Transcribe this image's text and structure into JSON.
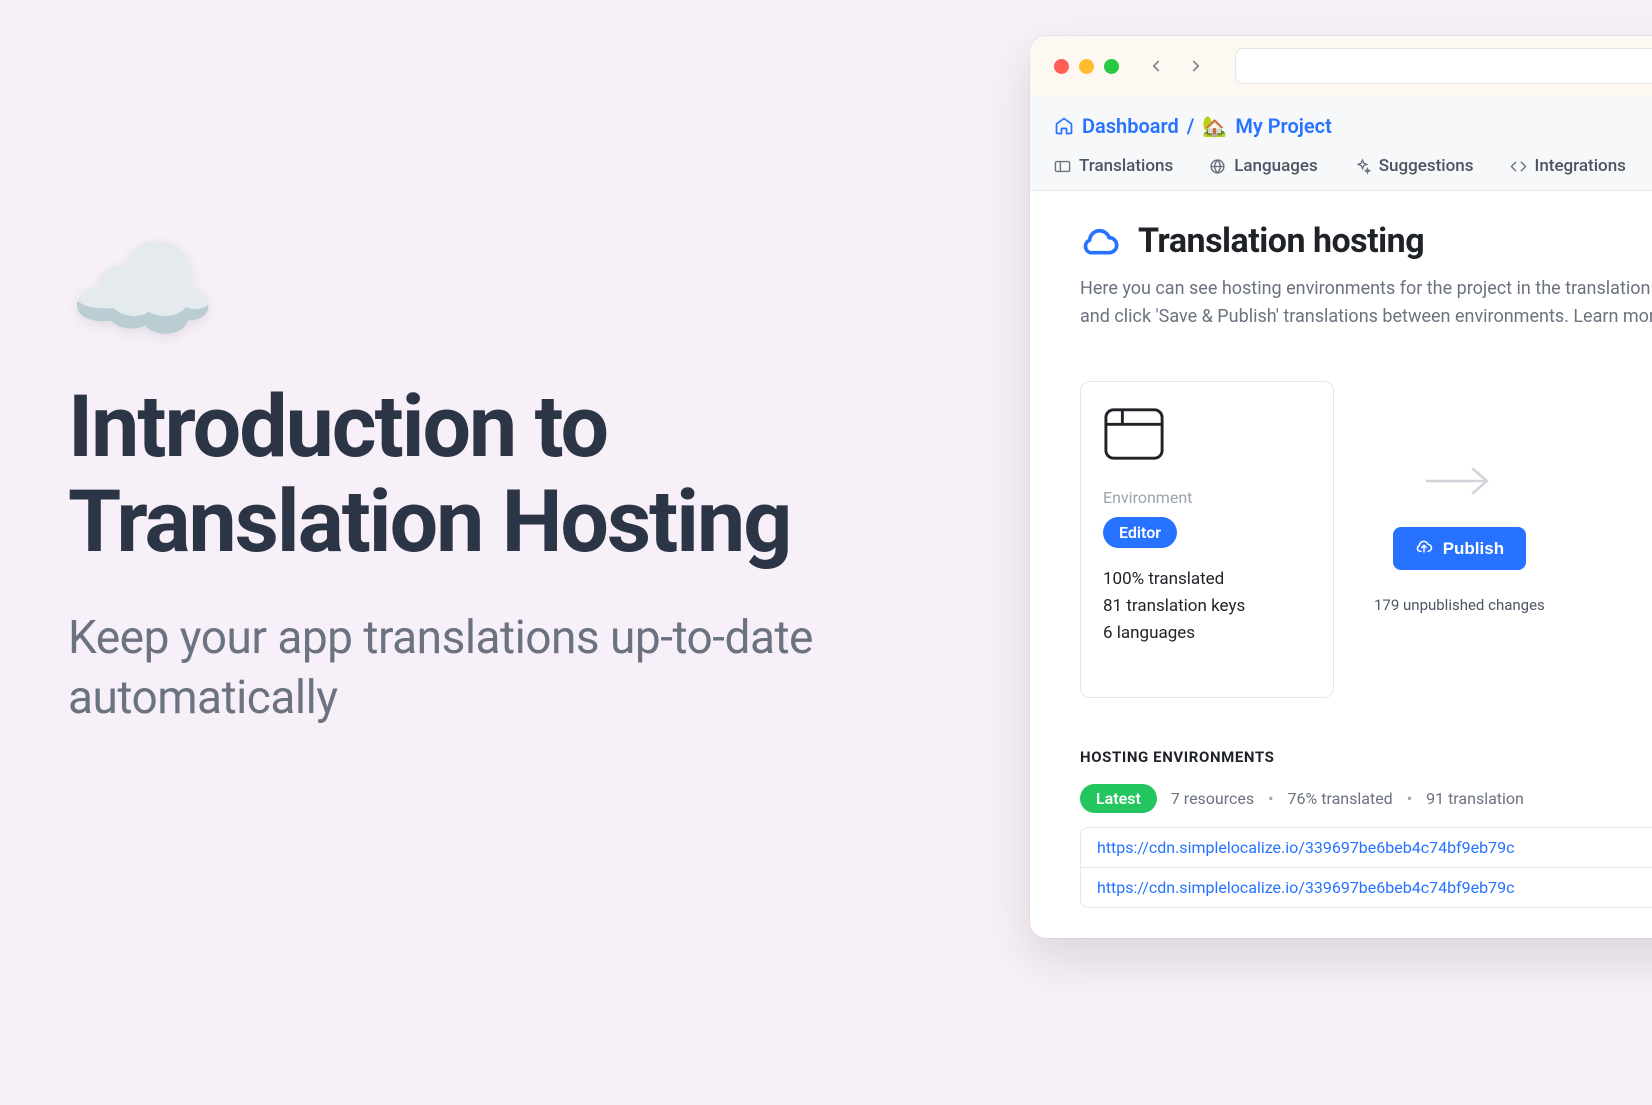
{
  "left": {
    "emoji": "☁️",
    "headline": "Introduction to Translation Hosting",
    "subhead": "Keep your app translations up-to-date automatically"
  },
  "breadcrumb": {
    "dashboard": "Dashboard",
    "project_emoji": "🏡",
    "project_name": "My Project"
  },
  "tabs": {
    "translations": "Translations",
    "languages": "Languages",
    "suggestions": "Suggestions",
    "integrations": "Integrations"
  },
  "page": {
    "title": "Translation hosting",
    "desc": "Here you can see hosting environments for the project in the translation editor and click 'Save & Publish' translations between environments. Learn more about"
  },
  "env": {
    "label": "Environment",
    "pill": "Editor",
    "stat1": "100% translated",
    "stat2": "81 translation keys",
    "stat3": "6 languages"
  },
  "publish": {
    "button": "Publish",
    "unpublished": "179 unpublished changes"
  },
  "hosting": {
    "heading": "HOSTING ENVIRONMENTS",
    "latest": "Latest",
    "resources": "7 resources",
    "translated": "76% translated",
    "keys": "91 translation",
    "url1": "https://cdn.simplelocalize.io/339697be6beb4c74bf9eb79c",
    "url2": "https://cdn.simplelocalize.io/339697be6beb4c74bf9eb79c"
  }
}
